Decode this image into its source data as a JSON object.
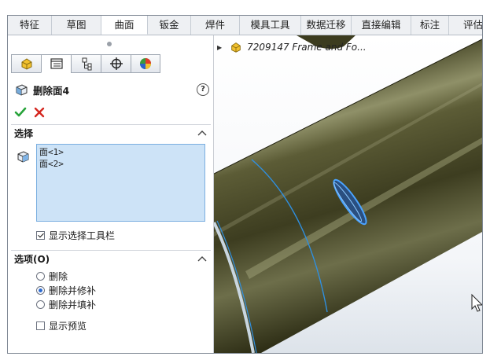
{
  "ribbon": {
    "tabs": [
      {
        "label": "特征",
        "active": false
      },
      {
        "label": "草图",
        "active": false
      },
      {
        "label": "曲面",
        "active": true
      },
      {
        "label": "钣金",
        "active": false
      },
      {
        "label": "焊件",
        "active": false
      },
      {
        "label": "模具工具",
        "active": false
      },
      {
        "label": "数据迁移",
        "active": false
      },
      {
        "label": "直接编辑",
        "active": false
      },
      {
        "label": "标注",
        "active": false
      },
      {
        "label": "评估",
        "active": false
      }
    ]
  },
  "property_manager": {
    "title": "删除面4",
    "help": "?",
    "tabs": [
      "feature-manager-icon",
      "property-manager-icon",
      "configuration-manager-icon",
      "dim-xpert-icon",
      "display-manager-icon"
    ],
    "sections": {
      "selection": {
        "label": "选择",
        "items": [
          "面<1>",
          "面<2>"
        ],
        "show_toolbar_label": "显示选择工具栏",
        "show_toolbar_checked": true
      },
      "options": {
        "label": "选项(O)",
        "radios": [
          {
            "label": "删除",
            "selected": false
          },
          {
            "label": "删除并修补",
            "selected": true
          },
          {
            "label": "删除并填补",
            "selected": false
          }
        ],
        "preview_label": "显示预览",
        "preview_checked": false
      }
    }
  },
  "feature_tree": {
    "part_name": "7209147 Frame and Fo..."
  },
  "colors": {
    "pipe_body": "#3b3b1f",
    "pipe_highlight": "#9c9d74",
    "edge_highlight": "#2f8fe0",
    "selection_box": "#cde3f7"
  }
}
